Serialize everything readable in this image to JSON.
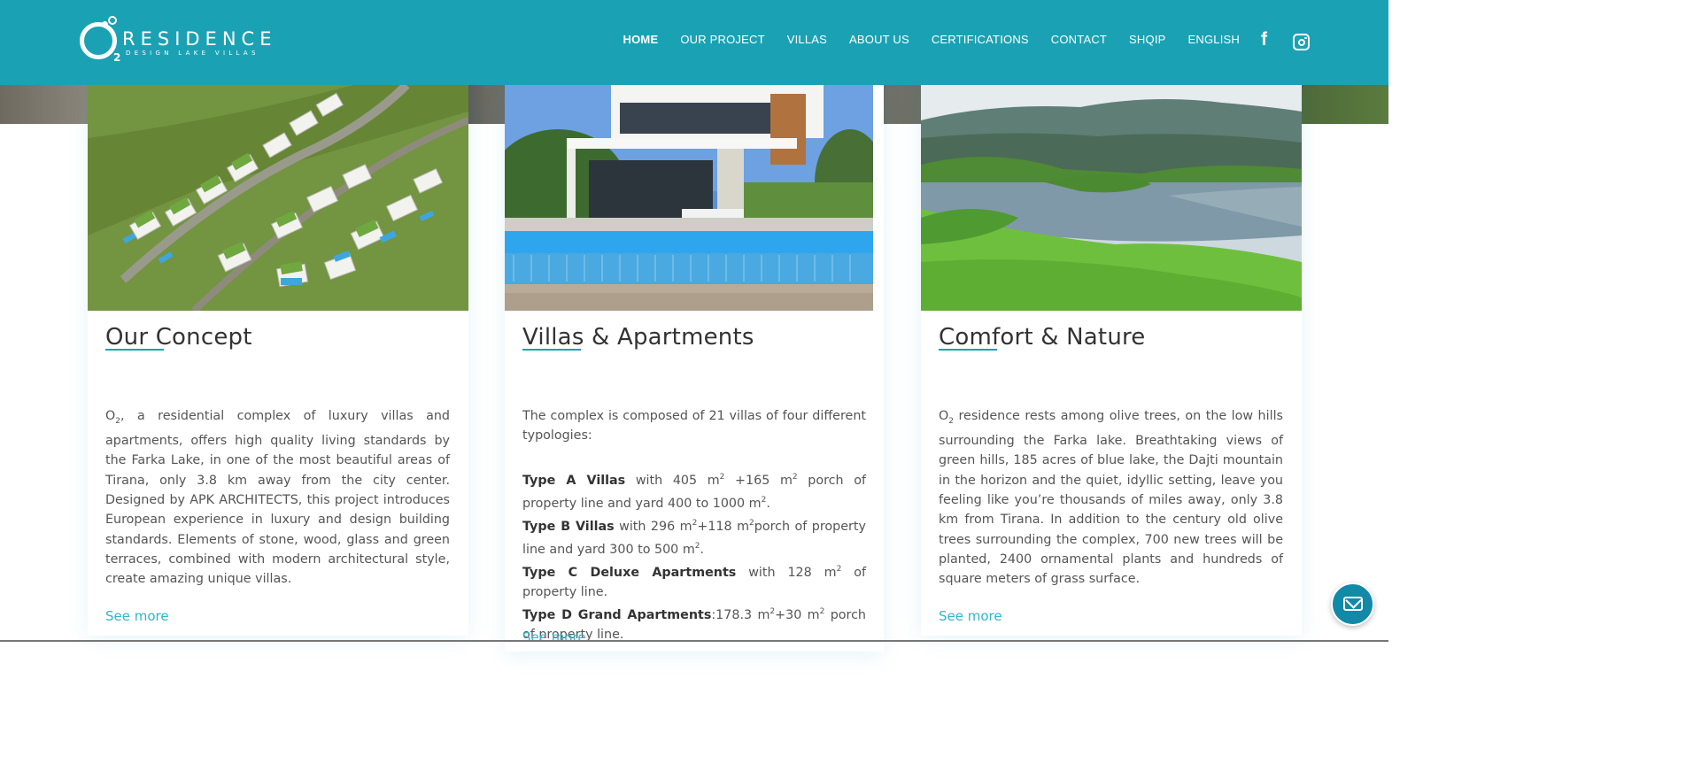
{
  "header": {
    "logo": {
      "name": "RESIDENCE",
      "tagline": "DESIGN LAKE VILLAS",
      "subscript": "2"
    },
    "nav": [
      {
        "label": "HOME",
        "active": true
      },
      {
        "label": "OUR PROJECT",
        "active": false
      },
      {
        "label": "VILLAS",
        "active": false
      },
      {
        "label": "ABOUT US",
        "active": false
      },
      {
        "label": "CERTIFICATIONS",
        "active": false
      },
      {
        "label": "CONTACT",
        "active": false
      },
      {
        "label": "SHQIP",
        "active": false
      },
      {
        "label": "ENGLISH",
        "active": false
      }
    ],
    "social": {
      "facebook_glyph": "f",
      "icons": [
        "facebook-icon",
        "instagram-icon"
      ]
    },
    "color": "#1aa2b4"
  },
  "cards": [
    {
      "title": "Our Concept",
      "see_more": "See more"
    },
    {
      "title": "Villas & Apartments",
      "see_more": "See more"
    },
    {
      "title": "Comfort & Nature",
      "see_more": "See more"
    }
  ],
  "text": {
    "c1_o": "O",
    "c1_sub": "2",
    "c1_body": ", a residential complex of luxury villas and apartments, offers high quality living standards by the Farka Lake, in one of the most beautiful areas of Tirana, only 3.8 km away from the city center. Designed by APK ARCHITECTS, this project introduces European experience in luxury and design building standards. Elements of stone, wood, glass and green terraces, combined with modern architectural style, create amazing unique villas.",
    "c2_intro": "The complex is composed of 21 villas of four different typologies:",
    "c2_a_name": "Type A Villas",
    "c2_a_1": " with 405 m",
    "c2_a_2": " +165 m",
    "c2_a_3": " porch of property line and yard 400 to 1000 m",
    "c2_b_name": "Type B Villas",
    "c2_b_1": " with 296 m",
    "c2_b_2": "+118 m",
    "c2_b_3": "porch of property line and yard 300 to 500 m",
    "c2_c_name": "Type C Deluxe Apartments",
    "c2_c_1": " with 128 m",
    "c2_c_2": " of property line.",
    "c2_d_name": "Type D Grand Apartments",
    "c2_d_1": ":178.3 m",
    "c2_d_2": "+30 m",
    "c2_d_3": " porch of property line.",
    "sup2": "2",
    "period": ".",
    "c3_o": "O",
    "c3_sub": "2",
    "c3_body": " residence rests among olive trees, on the low hills surrounding the Farka lake. Breathtaking views of green hills, 185 acres of blue lake, the Dajti mountain in the horizon and the quiet, idyllic setting, leave you feeling like you’re thousands of miles away, only 3.8 km from Tirana.  In addition to the century old olive trees surrounding the complex, 700 new trees will be planted, 2400 ornamental plants and hundreds of square meters of grass surface."
  },
  "contact_fab": {
    "icon": "mail-icon"
  }
}
